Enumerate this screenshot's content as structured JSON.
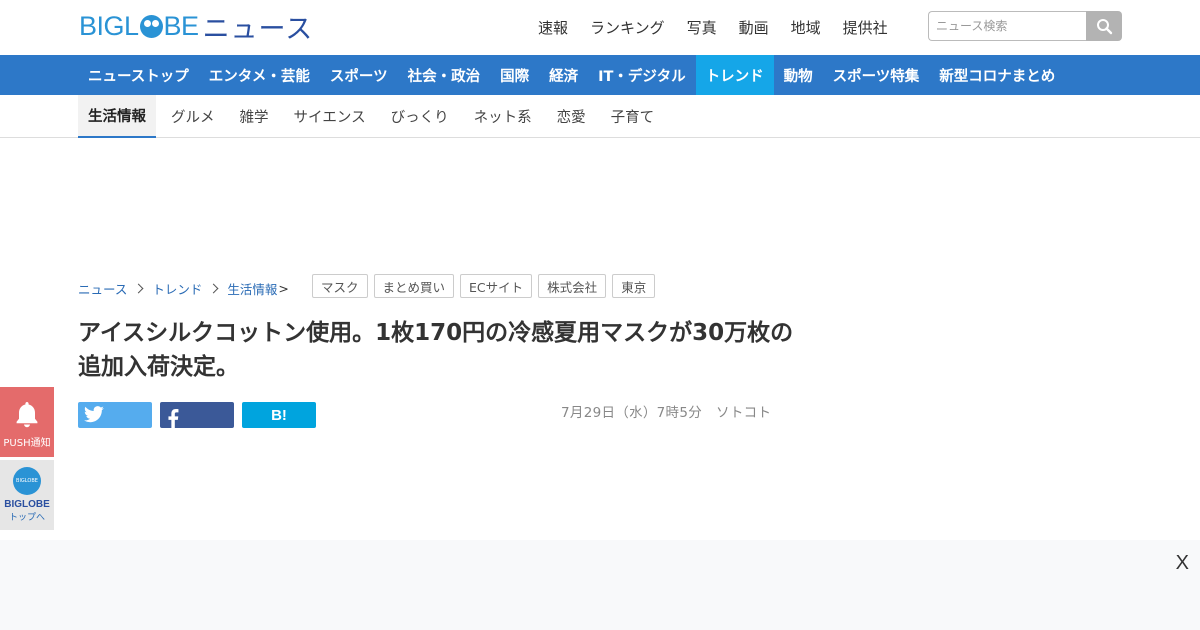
{
  "header": {
    "logo_text": "BIGLOBE",
    "logo_news": "ニュース",
    "nav": [
      "速報",
      "ランキング",
      "写真",
      "動画",
      "地域",
      "提供社"
    ],
    "search_placeholder": "ニュース検索"
  },
  "categories": {
    "items": [
      "ニューストップ",
      "エンタメ・芸能",
      "スポーツ",
      "社会・政治",
      "国際",
      "経済",
      "IT・デジタル",
      "トレンド",
      "動物",
      "スポーツ特集",
      "新型コロナまとめ"
    ],
    "active": "トレンド"
  },
  "subnav": {
    "items": [
      "生活情報",
      "グルメ",
      "雑学",
      "サイエンス",
      "びっくり",
      "ネット系",
      "恋愛",
      "子育て"
    ],
    "active": "生活情報"
  },
  "breadcrumb": {
    "items": [
      "ニュース",
      "トレンド",
      "生活情報"
    ],
    "end": ">"
  },
  "tags": [
    "マスク",
    "まとめ買い",
    "ECサイト",
    "株式会社",
    "東京"
  ],
  "article": {
    "headline": "アイスシルクコットン使用。1枚170円の冷感夏用マスクが30万枚の追加入荷決定。",
    "date": "7月29日（水）7時5分",
    "source": "ソトコト"
  },
  "share": {
    "hatena_label": "B!"
  },
  "side": {
    "push_label": "PUSH通知",
    "top_name": "BIGLOBE",
    "top_sub": "トップへ",
    "top_circle_text": "BIGLOBE"
  },
  "ad": {
    "close_label": "X"
  },
  "colors": {
    "brand_blue": "#2d78c8",
    "active_tab": "#15a6e8",
    "twitter": "#55acee",
    "facebook": "#3b5998",
    "hatena": "#00a4de",
    "push": "#e46b6b"
  }
}
